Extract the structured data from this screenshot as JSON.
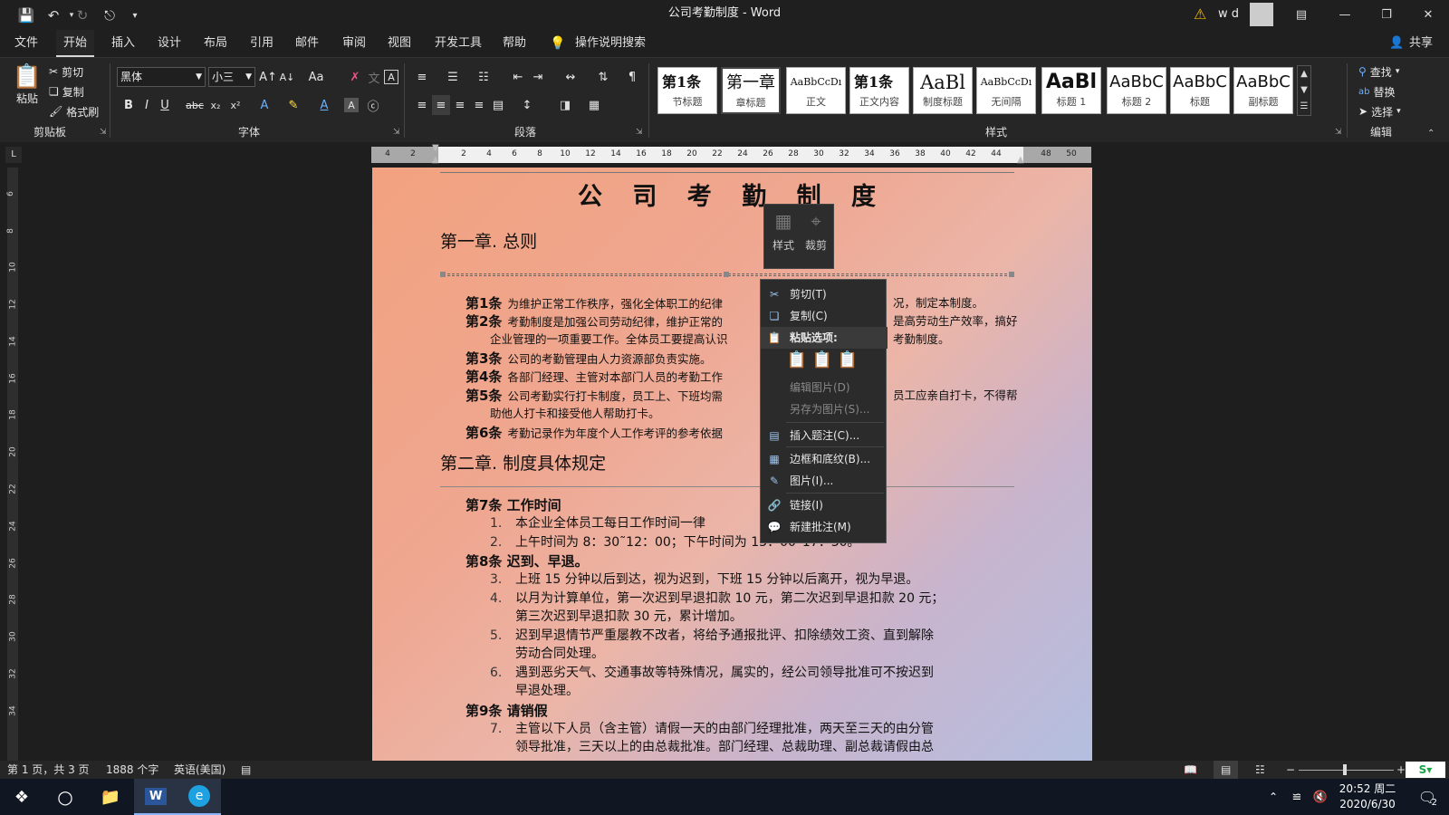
{
  "window": {
    "title": "公司考勤制度 - Word",
    "user": "w d"
  },
  "tabs": [
    "文件",
    "开始",
    "插入",
    "设计",
    "布局",
    "引用",
    "邮件",
    "审阅",
    "视图",
    "开发工具",
    "帮助"
  ],
  "tell_me": "操作说明搜索",
  "share": "共享",
  "ribbon": {
    "clipboard": {
      "paste": "粘贴",
      "cut": "剪切",
      "copy": "复制",
      "format_painter": "格式刷",
      "label": "剪贴板"
    },
    "font": {
      "name": "黑体",
      "size": "小三",
      "change_case": "Aa",
      "label": "字体"
    },
    "paragraph": {
      "label": "段落"
    },
    "styles": {
      "label": "样式",
      "items": [
        {
          "preview": "第1条",
          "name": "节标题"
        },
        {
          "preview": "第一章",
          "name": "章标题"
        },
        {
          "preview": "AaBbCcDı",
          "name": "正文"
        },
        {
          "preview": "第1条",
          "name": "正文内容"
        },
        {
          "preview": "AaBl",
          "name": "制度标题"
        },
        {
          "preview": "AaBbCcDı",
          "name": "无间隔"
        },
        {
          "preview": "AaBl",
          "name": "标题 1"
        },
        {
          "preview": "AaBbC",
          "name": "标题 2"
        },
        {
          "preview": "AaBbC",
          "name": "标题"
        },
        {
          "preview": "AaBbC",
          "name": "副标题"
        }
      ]
    },
    "editing": {
      "find": "查找",
      "replace": "替换",
      "select": "选择",
      "label": "编辑"
    }
  },
  "ruler": {
    "ticks": [
      "4",
      "2",
      "2",
      "4",
      "6",
      "8",
      "10",
      "12",
      "14",
      "16",
      "18",
      "20",
      "22",
      "24",
      "26",
      "28",
      "30",
      "32",
      "34",
      "36",
      "38",
      "40",
      "42",
      "44",
      "48",
      "50"
    ],
    "vticks": [
      "6",
      "8",
      "10",
      "12",
      "14",
      "16",
      "18",
      "20",
      "22",
      "24",
      "26",
      "28",
      "30",
      "32",
      "34"
    ]
  },
  "document": {
    "title": "公 司 考 勤 制 度",
    "chapter1": "第一章.  总则",
    "articles": [
      {
        "num": "第1条",
        "text": "为维护正常工作秩序，强化全体职工的纪律",
        "tail": "况，制定本制度。"
      },
      {
        "num": "第2条",
        "text": "考勤制度是加强公司劳动纪律，维护正常的",
        "tail": "是高劳动生产效率，搞好"
      },
      {
        "num": "",
        "text": "企业管理的一项重要工作。全体员工要提高认识",
        "tail": "考勤制度。"
      },
      {
        "num": "第3条",
        "text": "公司的考勤管理由人力资源部负责实施。",
        "tail": ""
      },
      {
        "num": "第4条",
        "text": "各部门经理、主管对本部门人员的考勤工作",
        "tail": ""
      },
      {
        "num": "第5条",
        "text": "公司考勤实行打卡制度，员工上、下班均需",
        "tail": "员工应亲自打卡，不得帮"
      },
      {
        "num": "",
        "text": "助他人打卡和接受他人帮助打卡。",
        "tail": ""
      },
      {
        "num": "第6条",
        "text": "考勤记录作为年度个人工作考评的参考依据",
        "tail": ""
      }
    ],
    "chapter2": "第二章.  制度具体规定",
    "sections": [
      {
        "title": "第7条   工作时间",
        "items": [
          {
            "n": "1.",
            "lines": [
              "本企业全体员工每日工作时间一律"
            ]
          },
          {
            "n": "2.",
            "lines": [
              "上午时间为 8：30˜12：00；下午时间为 13：00˜17：30。"
            ]
          }
        ]
      },
      {
        "title": "第8条   迟到、早退。",
        "items": [
          {
            "n": "3.",
            "lines": [
              "上班 15 分钟以后到达，视为迟到，下班 15 分钟以后离开，视为早退。"
            ]
          },
          {
            "n": "4.",
            "lines": [
              "以月为计算单位，第一次迟到早退扣款 10 元，第二次迟到早退扣款 20 元；",
              "第三次迟到早退扣款 30 元，累计增加。"
            ]
          },
          {
            "n": "5.",
            "lines": [
              "迟到早退情节严重屡教不改者，将给予通报批评、扣除绩效工资、直到解除",
              "劳动合同处理。"
            ]
          },
          {
            "n": "6.",
            "lines": [
              "遇到恶劣天气、交通事故等特殊情况，属实的，经公司领导批准可不按迟到",
              "早退处理。"
            ]
          }
        ]
      },
      {
        "title": "第9条   请销假",
        "items": [
          {
            "n": "7.",
            "lines": [
              "主管以下人员（含主管）请假一天的由部门经理批准，两天至三天的由分管",
              "领导批准，三天以上的由总裁批准。部门经理、总裁助理、副总裁请假由总"
            ]
          }
        ]
      }
    ]
  },
  "mini_toolbar": {
    "style": "样式",
    "crop": "裁剪"
  },
  "context_menu": {
    "cut": "剪切(T)",
    "copy": "复制(C)",
    "paste_header": "粘贴选项:",
    "edit_picture": "编辑图片(D)",
    "save_as_picture": "另存为图片(S)...",
    "insert_caption": "插入题注(C)...",
    "borders": "边框和底纹(B)...",
    "picture": "图片(I)...",
    "link": "链接(I)",
    "new_comment": "新建批注(M)"
  },
  "status": {
    "page": "第 1 页，共 3 页",
    "words": "1888 个字",
    "language": "英语(美国)"
  },
  "taskbar": {
    "time": "20:52 周二",
    "date": "2020/6/30",
    "notif_count": "2"
  }
}
